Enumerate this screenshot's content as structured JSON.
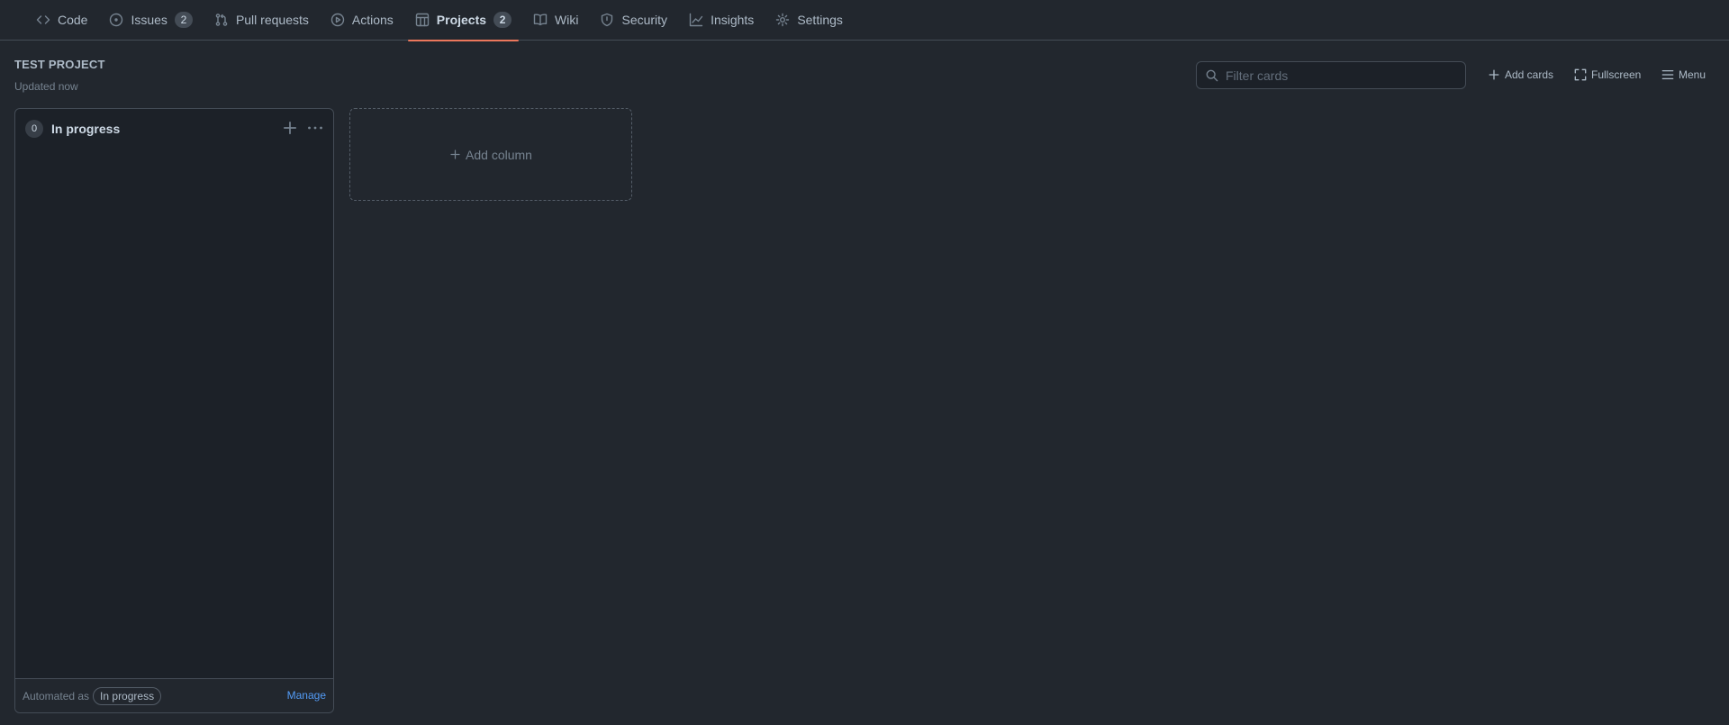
{
  "nav": {
    "tabs": [
      {
        "label": "Code",
        "icon": "code-icon"
      },
      {
        "label": "Issues",
        "icon": "issue-opened-icon",
        "counter": "2"
      },
      {
        "label": "Pull requests",
        "icon": "git-pull-request-icon"
      },
      {
        "label": "Actions",
        "icon": "play-icon"
      },
      {
        "label": "Projects",
        "icon": "project-icon",
        "counter": "2",
        "selected": true
      },
      {
        "label": "Wiki",
        "icon": "book-icon"
      },
      {
        "label": "Security",
        "icon": "shield-icon"
      },
      {
        "label": "Insights",
        "icon": "graph-icon"
      },
      {
        "label": "Settings",
        "icon": "gear-icon"
      }
    ],
    "accent_color": "#ec775c"
  },
  "project": {
    "title": "TEST PROJECT",
    "updated": "Updated now"
  },
  "toolbar": {
    "filter_placeholder": "Filter cards",
    "add_cards_label": "Add cards",
    "fullscreen_label": "Fullscreen",
    "menu_label": "Menu"
  },
  "columns": [
    {
      "count": "0",
      "name": "In progress",
      "automated_prefix": "Automated as",
      "automated_value": "In progress",
      "manage_label": "Manage"
    }
  ],
  "add_column_label": "Add column",
  "colors": {
    "background": "#22272e",
    "column_background": "#1c2128",
    "border": "#444c56",
    "link": "#539bf5"
  }
}
